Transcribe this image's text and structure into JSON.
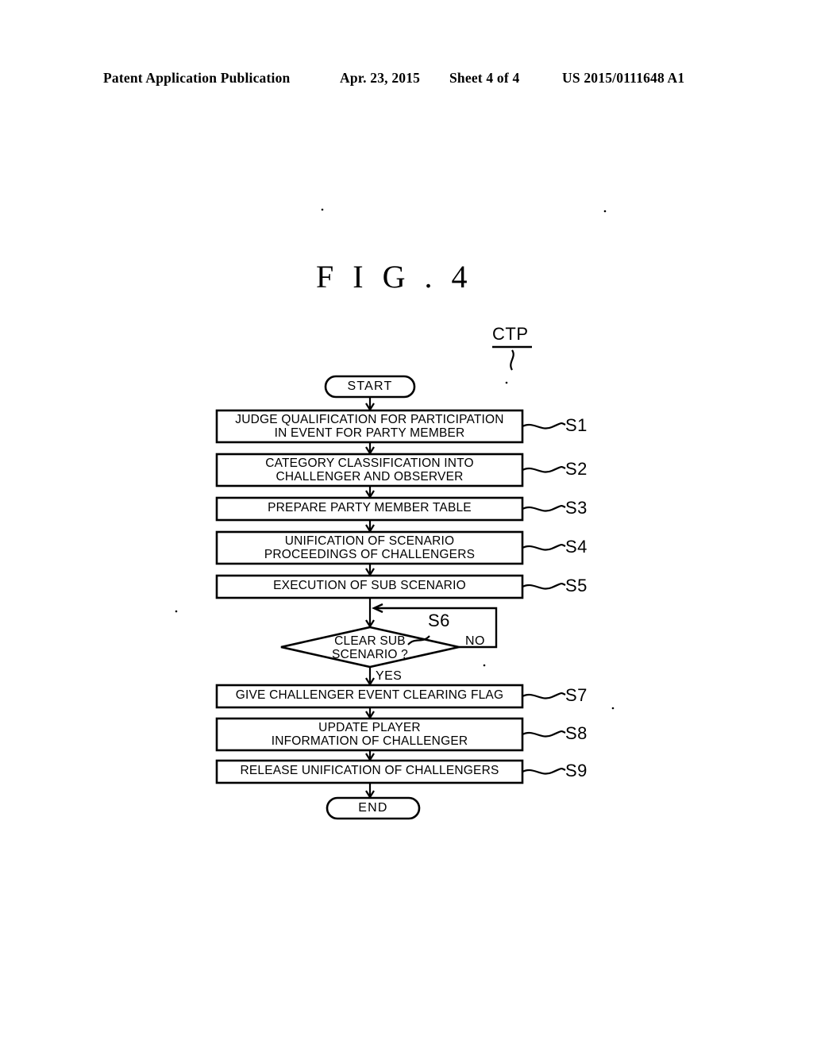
{
  "header": {
    "publication": "Patent Application Publication",
    "date": "Apr. 23, 2015",
    "sheet": "Sheet 4 of 4",
    "patent_number": "US 2015/0111648 A1"
  },
  "figure": {
    "title": "F I G . 4",
    "reference_label": "CTP"
  },
  "flowchart": {
    "start_label": "START",
    "end_label": "END",
    "yes_label": "YES",
    "no_label": "NO",
    "steps": [
      {
        "tag": "S1",
        "text": "JUDGE QUALIFICATION FOR PARTICIPATION\nIN EVENT FOR PARTY MEMBER"
      },
      {
        "tag": "S2",
        "text": "CATEGORY CLASSIFICATION INTO\nCHALLENGER AND OBSERVER"
      },
      {
        "tag": "S3",
        "text": "PREPARE PARTY MEMBER TABLE"
      },
      {
        "tag": "S4",
        "text": "UNIFICATION OF SCENARIO\nPROCEEDINGS OF CHALLENGERS"
      },
      {
        "tag": "S5",
        "text": "EXECUTION OF SUB SCENARIO"
      },
      {
        "tag": "S6",
        "text": "CLEAR SUB\nSCENARIO ?"
      },
      {
        "tag": "S7",
        "text": "GIVE CHALLENGER EVENT CLEARING FLAG"
      },
      {
        "tag": "S8",
        "text": "UPDATE PLAYER\nINFORMATION OF CHALLENGER"
      },
      {
        "tag": "S9",
        "text": "RELEASE UNIFICATION OF CHALLENGERS"
      }
    ]
  },
  "colors": {
    "ink": "#000000",
    "paper": "#ffffff"
  }
}
